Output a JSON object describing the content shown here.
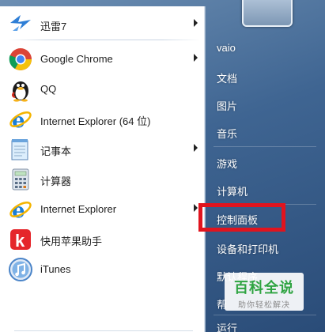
{
  "programs": [
    {
      "label": "迅雷7",
      "icon": "thunder-icon",
      "has_submenu": true
    },
    {
      "label": "Google Chrome",
      "icon": "chrome-icon",
      "has_submenu": true
    },
    {
      "label": "QQ",
      "icon": "qq-penguin-icon",
      "has_submenu": false
    },
    {
      "label": "Internet Explorer (64 位)",
      "icon": "internet-explorer-icon",
      "has_submenu": false
    },
    {
      "label": "记事本",
      "icon": "notepad-icon",
      "has_submenu": true
    },
    {
      "label": "计算器",
      "icon": "calculator-icon",
      "has_submenu": false
    },
    {
      "label": "Internet Explorer",
      "icon": "internet-explorer-icon",
      "has_submenu": true
    },
    {
      "label": "快用苹果助手",
      "icon": "kuaiyong-icon",
      "has_submenu": false
    },
    {
      "label": "iTunes",
      "icon": "itunes-icon",
      "has_submenu": false
    }
  ],
  "right_links": {
    "user": "vaio",
    "documents": "文档",
    "pictures": "图片",
    "music": "音乐",
    "games": "游戏",
    "computer": "计算机",
    "control_panel": "控制面板",
    "devices_printers": "设备和打印机",
    "default_programs": "默认程序",
    "help": "帮",
    "run": "运行"
  },
  "watermark": {
    "main": "百科全说",
    "sub": "助你轻松解决"
  },
  "colors": {
    "highlight_border": "#e0141e",
    "right_pane_bg": "#3f6592",
    "watermark_green": "#2ea441"
  }
}
